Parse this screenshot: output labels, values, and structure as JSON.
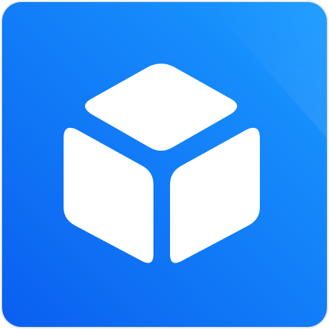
{
  "icon": {
    "name": "cube-icon",
    "colors": {
      "gradient_start": "#0a5ff0",
      "gradient_end": "#1a9bff",
      "glyph": "#ffffff",
      "border": "#e6e6e6"
    }
  }
}
